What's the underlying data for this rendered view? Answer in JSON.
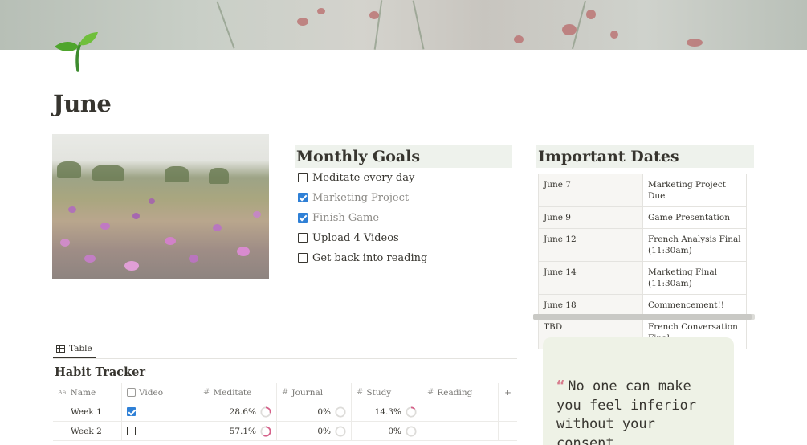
{
  "page": {
    "title": "June"
  },
  "monthly_goals": {
    "heading": "Monthly Goals",
    "items": [
      {
        "label": "Meditate every day",
        "checked": false
      },
      {
        "label": "Marketing Project",
        "checked": true
      },
      {
        "label": "Finish Game",
        "checked": true
      },
      {
        "label": "Upload 4 Videos",
        "checked": false
      },
      {
        "label": "Get back into reading",
        "checked": false
      }
    ]
  },
  "important_dates": {
    "heading": "Important Dates",
    "rows": [
      {
        "date": "June 7",
        "event": "Marketing Project Due"
      },
      {
        "date": "June 9",
        "event": "Game Presentation"
      },
      {
        "date": "June 12",
        "event": "French Analysis Final (11:30am)"
      },
      {
        "date": "June 14",
        "event": "Marketing Final (11:30am)"
      },
      {
        "date": "June 18",
        "event": "Commencement!!"
      },
      {
        "date": "TBD",
        "event": "French Conversation Final"
      }
    ]
  },
  "habit_tracker": {
    "view_tab": "Table",
    "title": "Habit Tracker",
    "columns": [
      "Name",
      "Video",
      "Meditate",
      "Journal",
      "Study",
      "Reading"
    ],
    "add_column": "+",
    "rows": [
      {
        "name": "Week 1",
        "video": true,
        "meditate": "28.6%",
        "meditate_progress": 0.286,
        "journal": "0%",
        "journal_progress": 0,
        "study": "14.3%",
        "study_progress": 0.143,
        "reading": ""
      },
      {
        "name": "Week 2",
        "video": false,
        "meditate": "57.1%",
        "meditate_progress": 0.571,
        "journal": "0%",
        "journal_progress": 0,
        "study": "0%",
        "study_progress": 0,
        "reading": ""
      }
    ]
  },
  "quote": {
    "mark": "“",
    "text": "No one can make you feel inferior without your consent"
  },
  "colors": {
    "accent_blue": "#2f80d6",
    "progress_pink": "#d6618a",
    "heading_bg": "#eef2ec",
    "quote_bg": "#eef2e6"
  },
  "icons": {
    "page_icon": "seedling-icon",
    "table_view": "table-icon",
    "title_property": "text-aa-icon",
    "checkbox_property": "checkbox-icon",
    "number_property": "hash-icon"
  }
}
